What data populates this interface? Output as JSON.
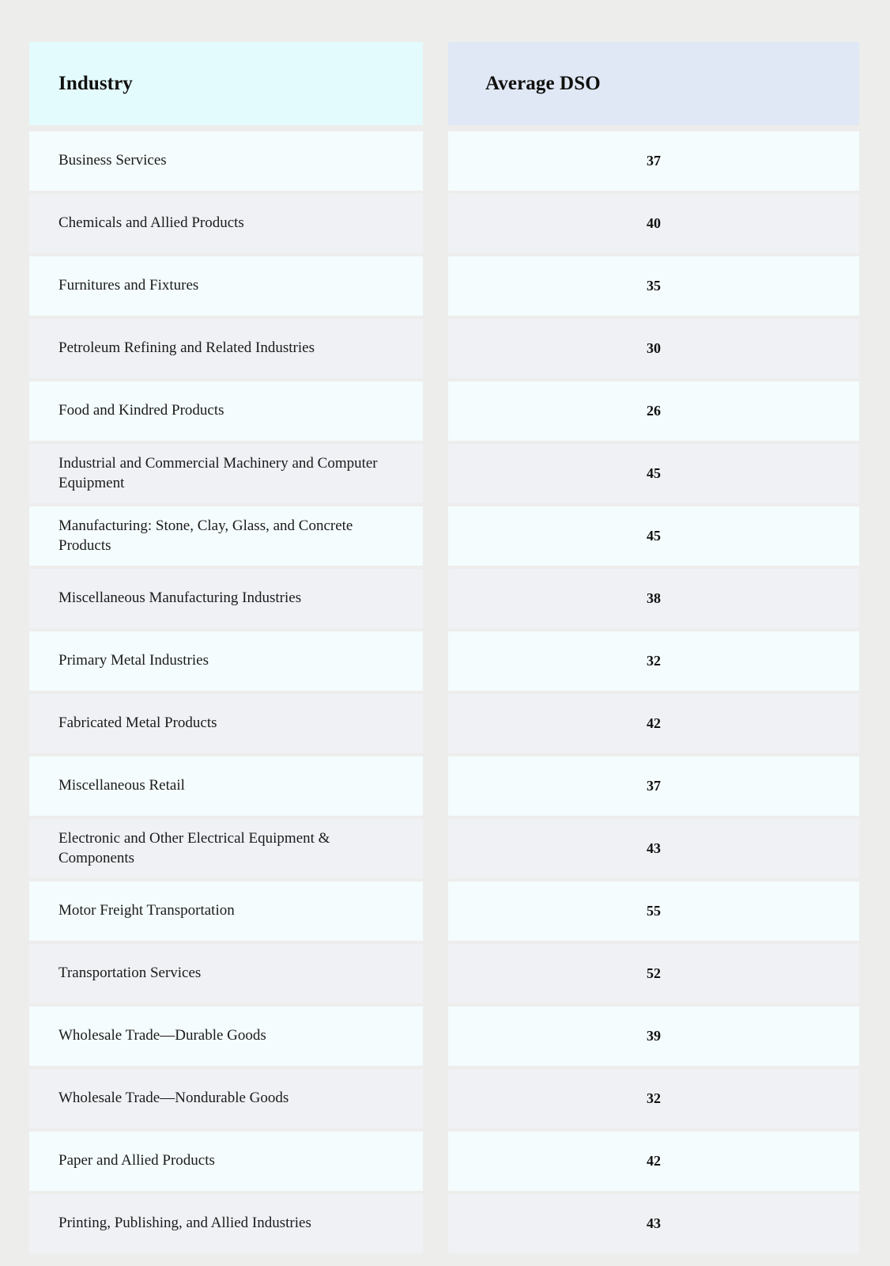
{
  "table": {
    "columns": [
      {
        "key": "industry",
        "label": "Industry",
        "header_bg": "#e4fbfd",
        "align": "left"
      },
      {
        "key": "dso",
        "label": "Average DSO",
        "header_bg": "#e1e8f5",
        "align": "center"
      }
    ],
    "row_colors": {
      "odd": "#f4fcfd",
      "even": "#eff1f5"
    },
    "page_background": "#ededec",
    "rows": [
      {
        "industry": "Business Services",
        "dso": "37"
      },
      {
        "industry": "Chemicals and Allied Products",
        "dso": "40"
      },
      {
        "industry": "Furnitures and Fixtures",
        "dso": "35"
      },
      {
        "industry": "Petroleum Refining and Related Industries",
        "dso": "30"
      },
      {
        "industry": "Food and Kindred Products",
        "dso": "26"
      },
      {
        "industry": "Industrial and Commercial Machinery and Computer Equipment",
        "dso": "45"
      },
      {
        "industry": "Manufacturing: Stone, Clay, Glass, and Concrete Products",
        "dso": "45"
      },
      {
        "industry": "Miscellaneous Manufacturing Industries",
        "dso": "38"
      },
      {
        "industry": "Primary Metal Industries",
        "dso": "32"
      },
      {
        "industry": "Fabricated Metal Products",
        "dso": "42"
      },
      {
        "industry": "Miscellaneous Retail",
        "dso": "37"
      },
      {
        "industry": "Electronic and Other Electrical Equipment & Components",
        "dso": "43"
      },
      {
        "industry": "Motor Freight Transportation",
        "dso": "55"
      },
      {
        "industry": "Transportation Services",
        "dso": "52"
      },
      {
        "industry": "Wholesale Trade—Durable Goods",
        "dso": "39"
      },
      {
        "industry": "Wholesale Trade—Nondurable Goods",
        "dso": "32"
      },
      {
        "industry": "Paper and Allied Products",
        "dso": "42"
      },
      {
        "industry": "Printing, Publishing, and Allied Industries",
        "dso": "43"
      }
    ]
  },
  "chart_data": {
    "type": "table",
    "title": "",
    "categories": [
      "Business Services",
      "Chemicals and Allied Products",
      "Furnitures and Fixtures",
      "Petroleum Refining and Related Industries",
      "Food and Kindred Products",
      "Industrial and Commercial Machinery and Computer Equipment",
      "Manufacturing: Stone, Clay, Glass, and Concrete Products",
      "Miscellaneous Manufacturing Industries",
      "Primary Metal Industries",
      "Fabricated Metal Products",
      "Miscellaneous Retail",
      "Electronic and Other Electrical Equipment & Components",
      "Motor Freight Transportation",
      "Transportation Services",
      "Wholesale Trade—Durable Goods",
      "Wholesale Trade—Nondurable Goods",
      "Paper and Allied Products",
      "Printing, Publishing, and Allied Industries"
    ],
    "values": [
      37,
      40,
      35,
      30,
      26,
      45,
      45,
      38,
      32,
      42,
      37,
      43,
      55,
      52,
      39,
      32,
      42,
      43
    ],
    "xlabel": "Industry",
    "ylabel": "Average DSO"
  }
}
